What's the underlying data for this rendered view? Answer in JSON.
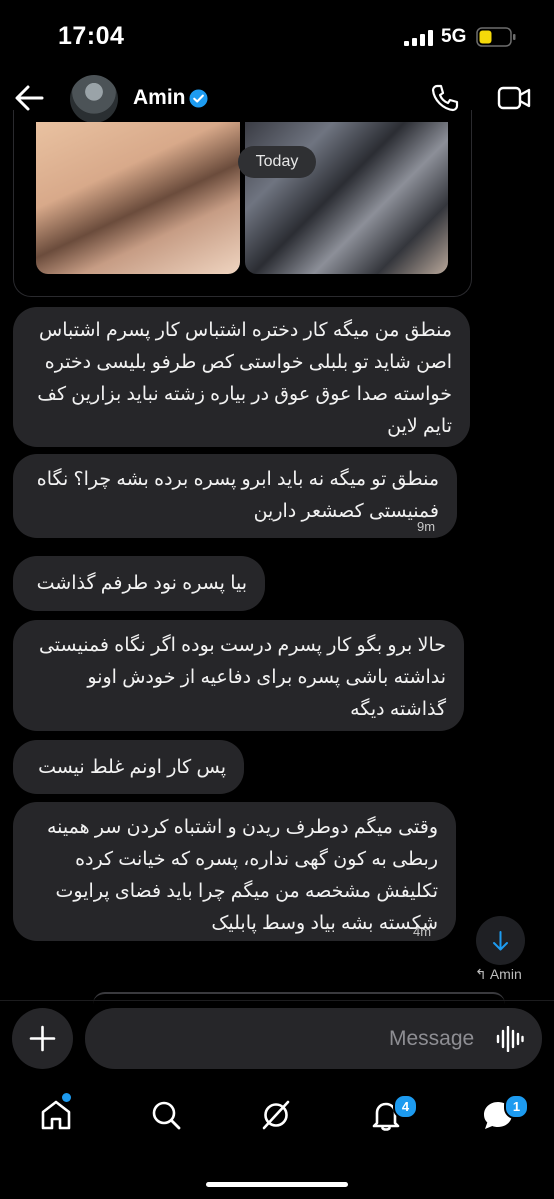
{
  "status_bar": {
    "time": "17:04",
    "network": "5G"
  },
  "header": {
    "contact_name": "Amin"
  },
  "media": {
    "date_divider": "Today"
  },
  "messages": [
    {
      "lines": [
        "منطق من میگه کار دختره اشتباس کار پسرم اشتباس",
        "اصن شاید تو بلبلی خواستی کص طرفو بلیسی دختره",
        "خواسته صدا عوق عوق در بیاره زشته نباید بزارین کف",
        "تایم لاین"
      ]
    },
    {
      "lines": [
        "منطق تو میگه نه باید ابرو پسره برده بشه چرا؟ نگاه",
        "فمنیستی کصشعر دارین"
      ],
      "time": "9m"
    },
    {
      "lines": [
        "بیا پسره نود طرفم گذاشت"
      ]
    },
    {
      "lines": [
        "حالا برو بگو کار پسرم درست بوده اگر نگاه فمنیستی",
        "نداشته باشی پسره برای دفاعیه از خودش اونو",
        "گذاشته دیگه"
      ]
    },
    {
      "lines": [
        "پس کار اونم غلط نیست"
      ]
    },
    {
      "lines": [
        "وقتی میگم دوطرف ریدن و اشتباه کردن سر همینه",
        "ربطی به کون گهی نداره، پسره که خیانت کرده",
        "تکلیفش مشخصه من میگم چرا باید فضای پرایوت",
        "شکسته بشه بیاد وسط پابلیک"
      ],
      "time": "4m"
    }
  ],
  "reply_tag": "↰ Amin",
  "composer": {
    "placeholder": "Message"
  },
  "tab_bar": {
    "notifications_badge": "4",
    "messages_badge": "1"
  },
  "colors": {
    "accent": "#1d9bf0",
    "bubble": "#262629",
    "battery": "#f5d90a"
  },
  "icons": [
    "back-arrow-icon",
    "verified-badge-icon",
    "phone-icon",
    "video-camera-icon",
    "arrow-down-icon",
    "plus-icon",
    "voice-wave-icon",
    "home-icon",
    "search-icon",
    "spaces-icon",
    "bell-icon",
    "messages-icon"
  ]
}
